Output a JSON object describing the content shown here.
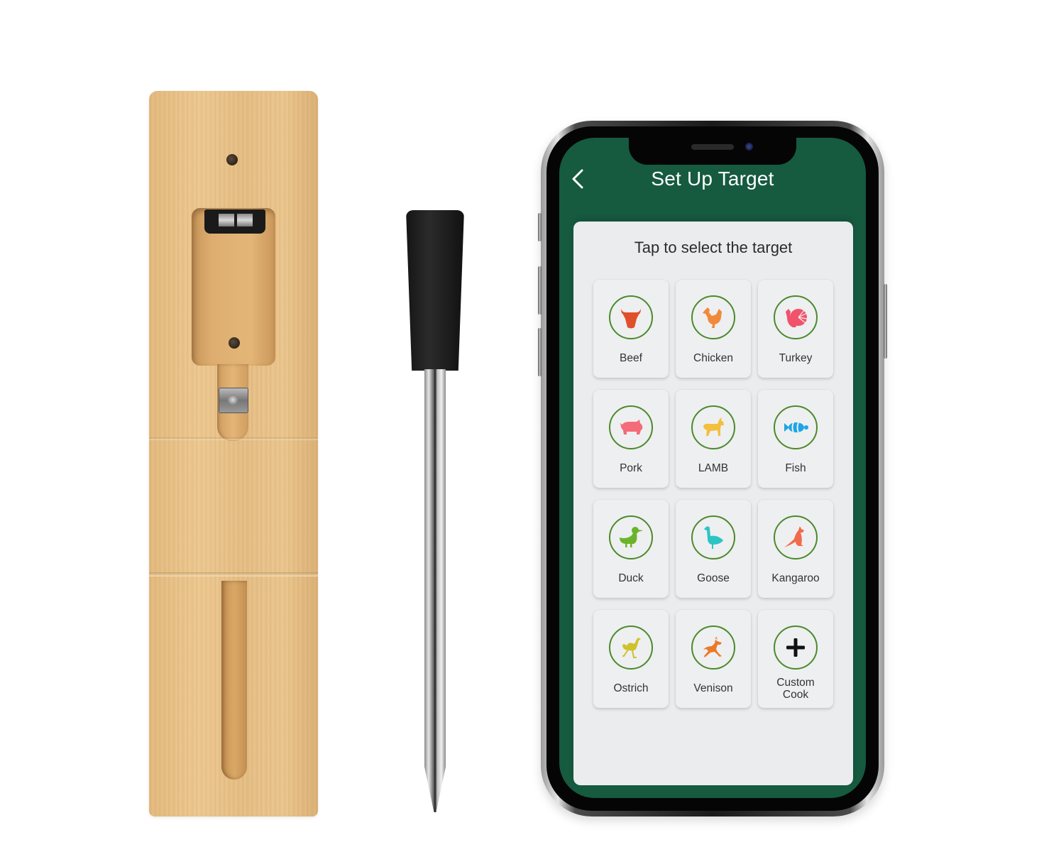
{
  "app": {
    "title": "Set Up Target",
    "subtitle": "Tap to select the target",
    "back_icon": "chevron-left-icon",
    "colors": {
      "header_green": "#165a40",
      "card_bg": "#ebecee",
      "ring_green": "#4b8a2a",
      "title_text": "#ffffff"
    }
  },
  "targets": [
    {
      "label": "Beef",
      "icon": "bull-head-icon",
      "color": "#e0502a"
    },
    {
      "label": "Chicken",
      "icon": "rooster-icon",
      "color": "#f08a3a"
    },
    {
      "label": "Turkey",
      "icon": "turkey-icon",
      "color": "#f0536a"
    },
    {
      "label": "Pork",
      "icon": "pig-icon",
      "color": "#f46b7a"
    },
    {
      "label": "LAMB",
      "icon": "goat-icon",
      "color": "#f3bf3c"
    },
    {
      "label": "Fish",
      "icon": "fish-icon",
      "color": "#1da5e6"
    },
    {
      "label": "Duck",
      "icon": "duck-icon",
      "color": "#6bb42a"
    },
    {
      "label": "Goose",
      "icon": "goose-icon",
      "color": "#2ec4c4"
    },
    {
      "label": "Kangaroo",
      "icon": "kangaroo-icon",
      "color": "#f26a4a"
    },
    {
      "label": "Ostrich",
      "icon": "ostrich-icon",
      "color": "#cfc22a"
    },
    {
      "label": "Venison",
      "icon": "deer-icon",
      "color": "#ea7a2a"
    },
    {
      "label": "Custom\nCook",
      "label_line1": "Custom",
      "label_line2": "Cook",
      "icon": "plus-icon",
      "color": "#111111"
    }
  ],
  "product": {
    "dock": "bamboo-charging-dock",
    "probe": "meat-thermometer-probe"
  }
}
